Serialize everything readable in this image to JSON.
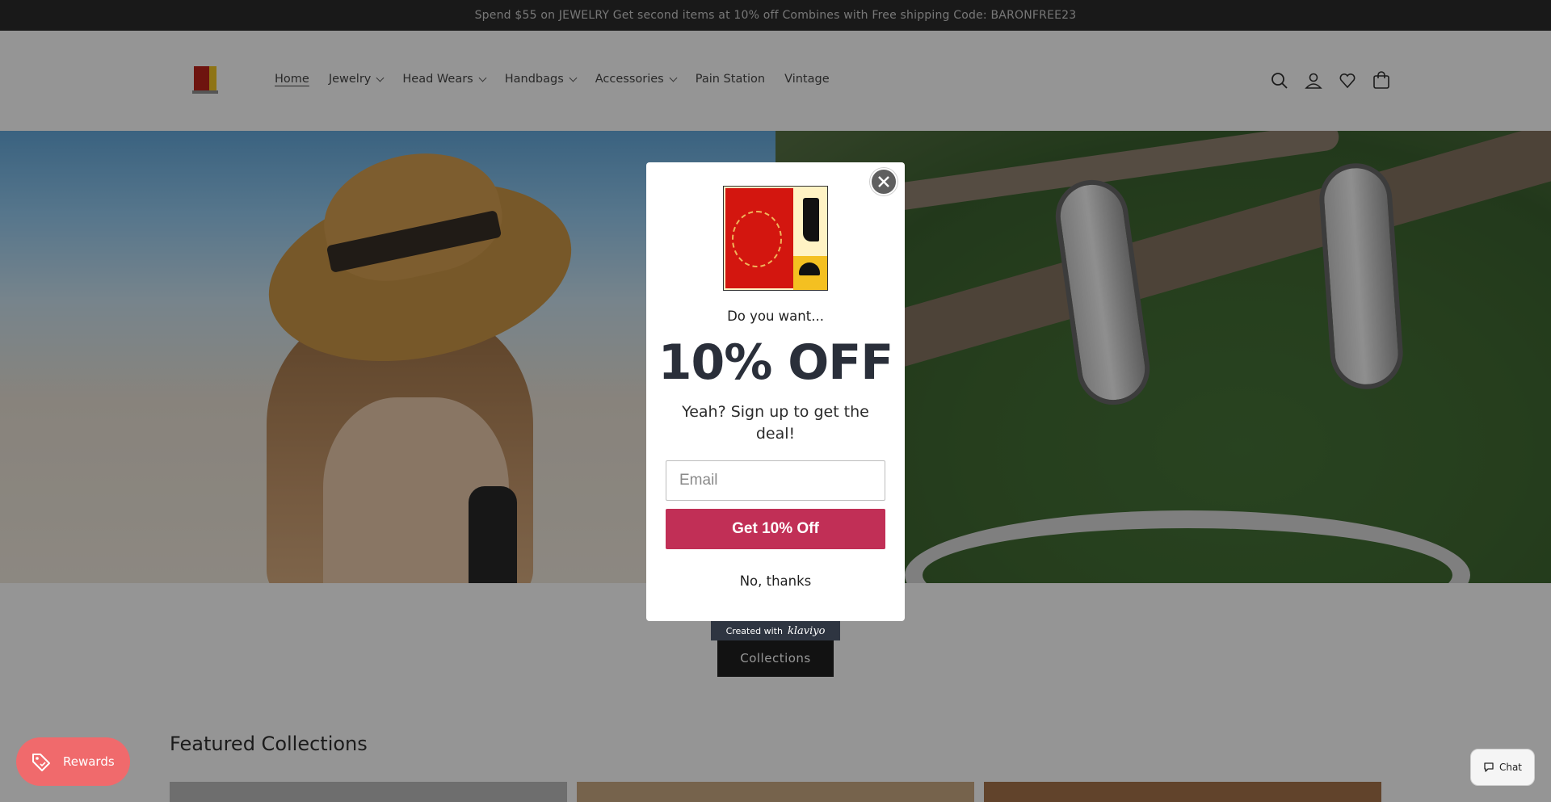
{
  "announcement": {
    "text": "Spend $55 on JEWELRY Get second items at 10% off Combines with Free shipping Code: BARONFREE23"
  },
  "header": {
    "nav": [
      {
        "label": "Home",
        "has_dropdown": false,
        "active": true
      },
      {
        "label": "Jewelry",
        "has_dropdown": true
      },
      {
        "label": "Head Wears",
        "has_dropdown": true
      },
      {
        "label": "Handbags",
        "has_dropdown": true
      },
      {
        "label": "Accessories",
        "has_dropdown": true
      },
      {
        "label": "Pain Station",
        "has_dropdown": false
      },
      {
        "label": "Vintage",
        "has_dropdown": false
      }
    ],
    "icons": [
      "search-icon",
      "account-icon",
      "wishlist-icon",
      "cart-icon"
    ]
  },
  "main": {
    "collections_button": "Collections",
    "featured_title": "Featured Collections"
  },
  "popup": {
    "prompt": "Do you want...",
    "offer": "10% OFF",
    "subline": "Yeah? Sign up to get the deal!",
    "email_placeholder": "Email",
    "cta_label": "Get 10% Off",
    "decline_label": "No, thanks",
    "badge_prefix": "Created with",
    "badge_brand": "klaviyo"
  },
  "widgets": {
    "rewards_label": "Rewards",
    "chat_label": "Chat"
  },
  "colors": {
    "announcement_bg": "#1e1e1e",
    "cta": "#c12f56",
    "rewards": "#f06a6c",
    "offer_text": "#2a2f3a"
  }
}
